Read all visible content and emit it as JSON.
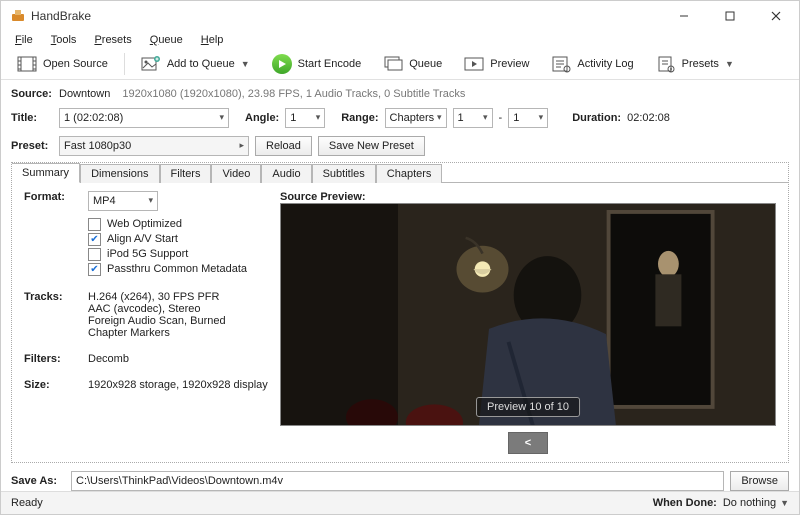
{
  "app": {
    "title": "HandBrake"
  },
  "menu": {
    "file": "File",
    "tools": "Tools",
    "presets": "Presets",
    "queue": "Queue",
    "help": "Help"
  },
  "toolbar": {
    "open_source": "Open Source",
    "add_to_queue": "Add to Queue",
    "start_encode": "Start Encode",
    "queue": "Queue",
    "preview": "Preview",
    "activity_log": "Activity Log",
    "presets": "Presets"
  },
  "source": {
    "label": "Source:",
    "name": "Downtown",
    "info": "1920x1080 (1920x1080), 23.98 FPS, 1 Audio Tracks, 0 Subtitle Tracks"
  },
  "title_row": {
    "title_label": "Title:",
    "title_value": "1 (02:02:08)",
    "angle_label": "Angle:",
    "angle_value": "1",
    "range_label": "Range:",
    "range_type": "Chapters",
    "range_from": "1",
    "range_dash": "-",
    "range_to": "1",
    "duration_label": "Duration:",
    "duration_value": "02:02:08"
  },
  "preset_row": {
    "label": "Preset:",
    "value": "Fast 1080p30",
    "reload": "Reload",
    "save_new": "Save New Preset"
  },
  "tabs": {
    "summary": "Summary",
    "dimensions": "Dimensions",
    "filters": "Filters",
    "video": "Video",
    "audio": "Audio",
    "subtitles": "Subtitles",
    "chapters": "Chapters"
  },
  "summary": {
    "format_label": "Format:",
    "format_value": "MP4",
    "web_optimized": "Web Optimized",
    "align_av": "Align A/V Start",
    "ipod": "iPod 5G Support",
    "passthru": "Passthru Common Metadata",
    "tracks_label": "Tracks:",
    "track1": "H.264 (x264), 30 FPS PFR",
    "track2": "AAC (avcodec), Stereo",
    "track3": "Foreign Audio Scan, Burned",
    "track4": "Chapter Markers",
    "filters_label": "Filters:",
    "filters_value": "Decomb",
    "size_label": "Size:",
    "size_value": "1920x928 storage, 1920x928 display",
    "preview_label": "Source Preview:",
    "preview_badge": "Preview 10 of 10",
    "prev_nav": "<"
  },
  "saveas": {
    "label": "Save As:",
    "value": "C:\\Users\\ThinkPad\\Videos\\Downtown.m4v",
    "browse": "Browse"
  },
  "status": {
    "ready": "Ready",
    "when_done_label": "When Done:",
    "when_done_value": "Do nothing"
  }
}
